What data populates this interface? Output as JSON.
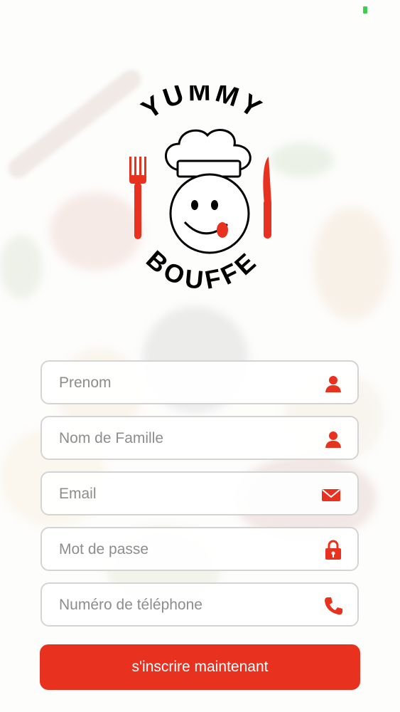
{
  "brand": {
    "line1": "YUMMY",
    "line2": "BOUFFE",
    "accent": "#e8321f"
  },
  "form": {
    "fields": [
      {
        "placeholder": "Prenom",
        "icon": "user-icon"
      },
      {
        "placeholder": "Nom de Famille",
        "icon": "user-icon"
      },
      {
        "placeholder": "Email",
        "icon": "envelope-icon"
      },
      {
        "placeholder": "Mot de passe",
        "icon": "lock-icon"
      },
      {
        "placeholder": "Numéro de téléphone",
        "icon": "phone-icon"
      }
    ],
    "submit_label": "s'inscrire maintenant"
  },
  "colors": {
    "accent": "#e8321f",
    "field_border": "#d4d4d4",
    "placeholder": "#8d8d8d"
  }
}
